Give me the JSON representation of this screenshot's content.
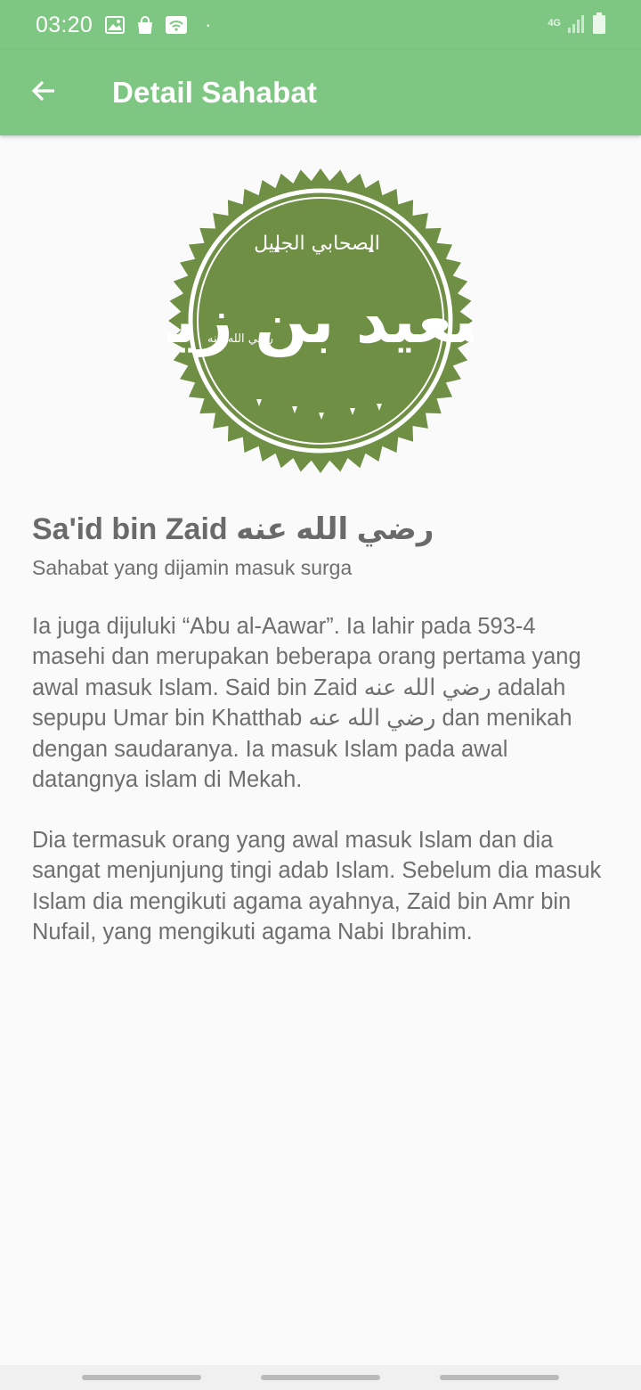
{
  "status_bar": {
    "time": "03:20",
    "network": "4G",
    "icons": [
      "image-icon",
      "shopping-bag-icon",
      "wifi-icon",
      "signal-icon",
      "battery-icon"
    ]
  },
  "app_bar": {
    "title": "Detail Sahabat",
    "back_icon": "arrow-left-icon"
  },
  "profile": {
    "seal_text_large": "سعيد بن زيد",
    "seal_text_top": "الصحابي الجليل",
    "seal_text_small": "رضي الله عنه",
    "name": "Sa'id bin Zaid رضي الله عنه",
    "subtitle": "Sahabat yang dijamin masuk surga",
    "paragraph_1": "Ia juga dijuluki “Abu al-Aawar”. Ia lahir pada 593-4 masehi dan merupakan beberapa orang pertama yang awal masuk Islam. Said bin Zaid رضي الله عنه adalah sepupu Umar bin Khatthab رضي الله عنه dan menikah dengan saudaranya. Ia masuk Islam pada awal datangnya islam di Mekah.",
    "paragraph_2": "Dia termasuk orang yang awal masuk Islam dan dia sangat menjunjung tingi adab Islam. Sebelum dia masuk Islam dia mengikuti agama ayahnya, Zaid bin Amr bin Nufail, yang mengikuti agama Nabi Ibrahim."
  },
  "colors": {
    "primary": "#7ec782",
    "seal": "#6f8f45",
    "text": "#6f6f6f",
    "background": "#fafafa"
  }
}
